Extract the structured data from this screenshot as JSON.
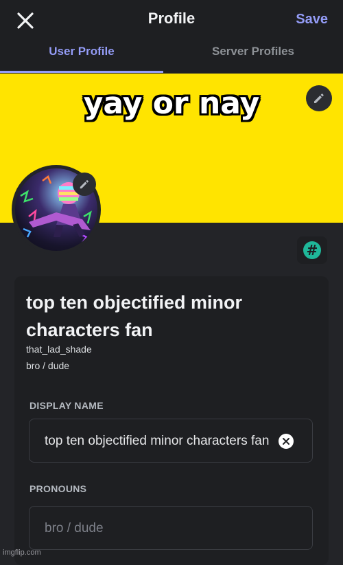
{
  "header": {
    "title": "Profile",
    "save_label": "Save",
    "close_icon": "close-icon"
  },
  "tabs": [
    {
      "label": "User Profile",
      "active": true
    },
    {
      "label": "Server Profiles",
      "active": false
    }
  ],
  "banner": {
    "color": "#ffe400",
    "caption": "yay or nay",
    "edit_icon": "pencil-icon"
  },
  "avatar": {
    "edit_icon": "pencil-icon"
  },
  "nitro_button": {
    "icon": "hashtag-icon",
    "symbol": "#"
  },
  "profile_card": {
    "display_name": "top ten objectified minor characters fan",
    "username": "that_lad_shade",
    "pronouns": "bro / dude"
  },
  "fields": {
    "display_name_label": "DISPLAY NAME",
    "display_name_value": "top ten objectified minor characters fan",
    "pronouns_label": "PRONOUNS",
    "pronouns_placeholder": "bro / dude"
  },
  "watermark": "imgflip.com",
  "colors": {
    "accent": "#949cf7",
    "background": "#232428",
    "card": "#1e1f22",
    "hash_green": "#1fb89a"
  }
}
